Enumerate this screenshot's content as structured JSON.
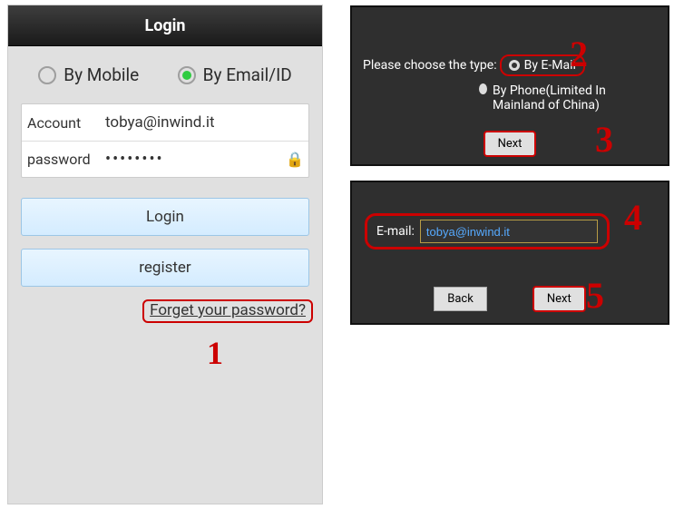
{
  "phone": {
    "title": "Login",
    "tab_mobile": "By Mobile",
    "tab_email": "By Email/ID",
    "account_label": "Account",
    "account_value": "tobya@inwind.it",
    "password_label": "password",
    "password_mask": "••••••••",
    "login_btn": "Login",
    "register_btn": "register",
    "forgot_link": "Forget your password?"
  },
  "panel1": {
    "prompt": "Please choose the type:",
    "opt_email": "By E-Mail",
    "opt_phone": "By Phone(Limited In Mainland of China)",
    "next_btn": "Next"
  },
  "panel2": {
    "email_label": "E-mail:",
    "email_value": "tobya@inwind.it",
    "back_btn": "Back",
    "next_btn": "Next"
  },
  "annotations": {
    "a1": "1",
    "a2": "2",
    "a3": "3",
    "a4": "4",
    "a5": "5"
  }
}
